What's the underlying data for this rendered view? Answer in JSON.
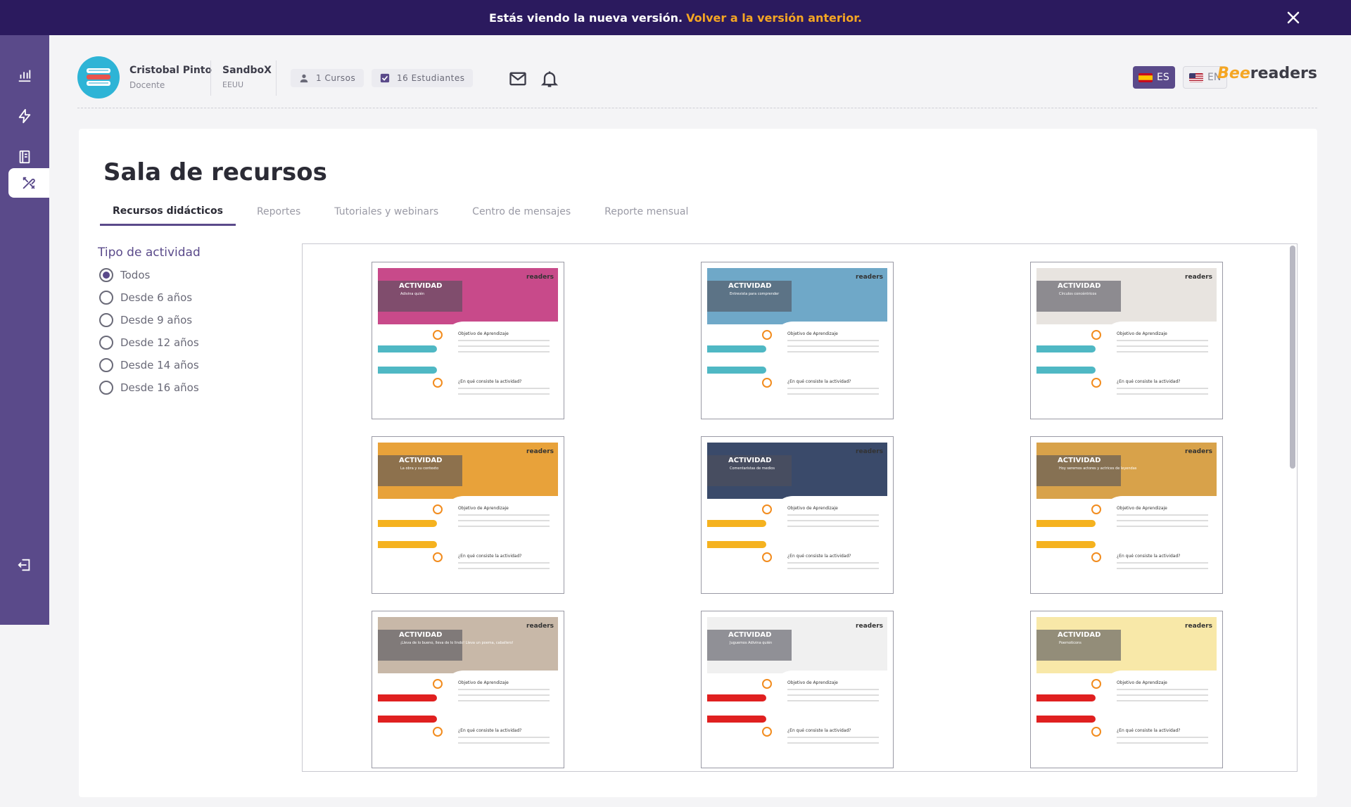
{
  "banner": {
    "text": "Estás viendo la nueva versión.",
    "link": "Volver a la versión anterior."
  },
  "sidebar": {
    "items": [
      {
        "name": "stats-icon",
        "active": false
      },
      {
        "name": "lightning-icon",
        "active": false
      },
      {
        "name": "book-icon",
        "active": false
      },
      {
        "name": "tools-icon",
        "active": true
      },
      {
        "name": "logout-icon",
        "active": false
      }
    ]
  },
  "header": {
    "user_name": "Cristobal Pinto",
    "user_role": "Docente",
    "school_name": "SandboX",
    "school_country": "EEUU",
    "courses": "1 Cursos",
    "students": "16 Estudiantes",
    "lang_es": "ES",
    "lang_en": "EN",
    "logo_bee": "Bee",
    "logo_readers": "readers"
  },
  "main": {
    "title": "Sala de recursos",
    "tabs": [
      {
        "label": "Recursos didácticos",
        "active": true
      },
      {
        "label": "Reportes",
        "active": false
      },
      {
        "label": "Tutoriales y webinars",
        "active": false
      },
      {
        "label": "Centro de mensajes",
        "active": false
      },
      {
        "label": "Reporte mensual",
        "active": false
      }
    ],
    "filter": {
      "title": "Tipo de actividad",
      "options": [
        {
          "label": "Todos",
          "selected": true
        },
        {
          "label": "Desde 6 años",
          "selected": false
        },
        {
          "label": "Desde 9 años",
          "selected": false
        },
        {
          "label": "Desde 12 años",
          "selected": false
        },
        {
          "label": "Desde 14 años",
          "selected": false
        },
        {
          "label": "Desde 16 años",
          "selected": false
        }
      ]
    },
    "resources": [
      {
        "label": "ACTIVIDAD",
        "subtitle": "Adivina quién",
        "accent": "#4fb8c4",
        "hero": "#c84a8a"
      },
      {
        "label": "ACTIVIDAD",
        "subtitle": "Entrevista para comprender",
        "accent": "#4fb8c4",
        "hero": "#6fa8c8"
      },
      {
        "label": "ACTIVIDAD",
        "subtitle": "Círculos concéntricos",
        "accent": "#4fb8c4",
        "hero": "#e8e4e0"
      },
      {
        "label": "ACTIVIDAD",
        "subtitle": "La obra y su contexto",
        "accent": "#f5b21f",
        "hero": "#e8a23a"
      },
      {
        "label": "ACTIVIDAD",
        "subtitle": "Comentaristas de medios",
        "accent": "#f5b21f",
        "hero": "#3a4a6a"
      },
      {
        "label": "ACTIVIDAD",
        "subtitle": "Hoy seremos actores y actrices de leyendas",
        "accent": "#f5b21f",
        "hero": "#d8a24a"
      },
      {
        "label": "ACTIVIDAD",
        "subtitle": "¡Lleva de lo bueno, lleva de lo lindo! Lleva un poema, caballero!",
        "accent": "#e02020",
        "hero": "#c8b8a8"
      },
      {
        "label": "ACTIVIDAD",
        "subtitle": "Juguemos Adivina quién",
        "accent": "#e02020",
        "hero": "#f0f0f0"
      },
      {
        "label": "ACTIVIDAD",
        "subtitle": "Poemoticons",
        "accent": "#e02020",
        "hero": "#f8e8a8"
      }
    ],
    "thumb_text": {
      "obj": "Objetivo de Aprendizaje",
      "que": "¿En qué consiste la actividad?",
      "brand": "readers"
    }
  },
  "colors": {
    "primary": "#5a4a8a",
    "banner": "#2b1a5e",
    "link": "#f5a623"
  }
}
